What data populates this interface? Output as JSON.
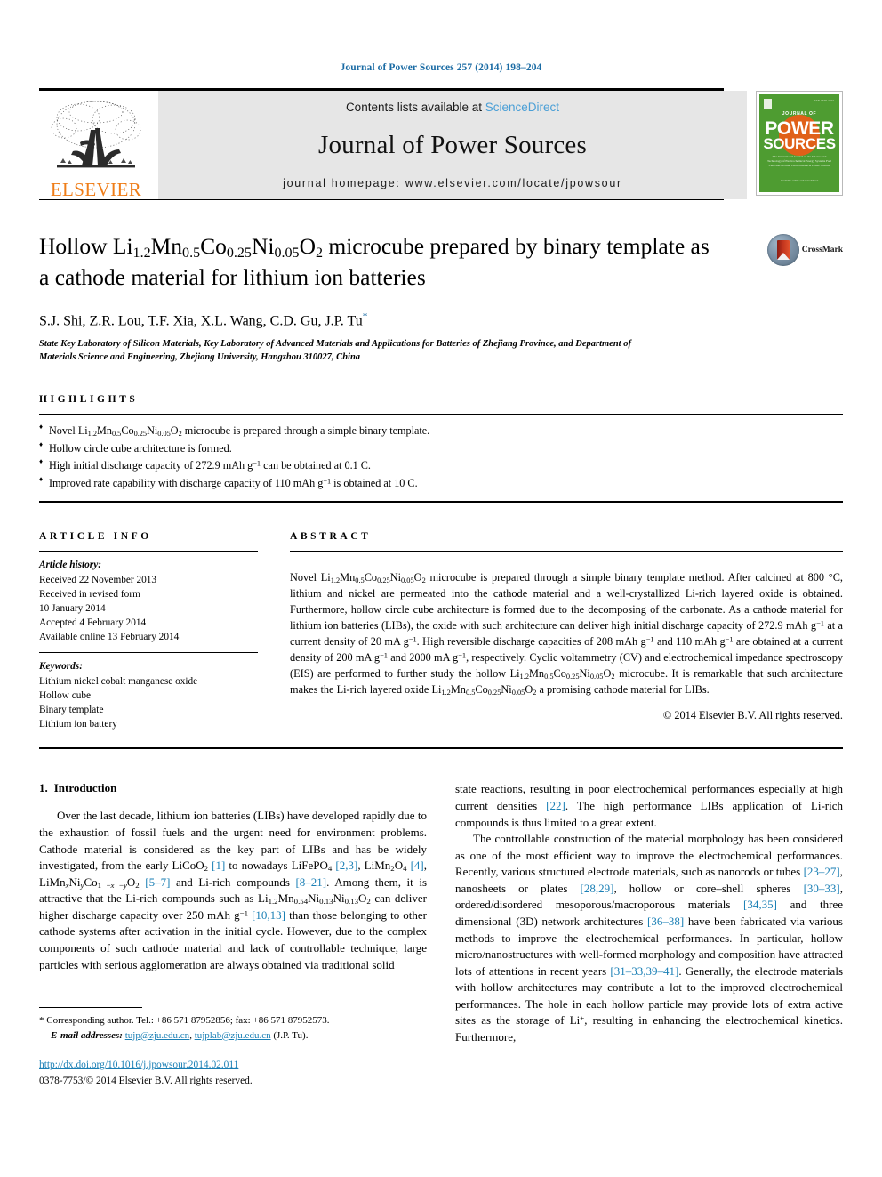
{
  "running_head": "Journal of Power Sources 257 (2014) 198–204",
  "masthead": {
    "publisher_logo_text": "ELSEVIER",
    "contents_prefix": "Contents lists available at ",
    "contents_link": "ScienceDirect",
    "journal_name": "Journal of Power Sources",
    "homepage_line": "journal homepage: www.elsevier.com/locate/jpowsour",
    "cover": {
      "journal_of": "JOURNAL OF",
      "power": "POWER",
      "sources": "SOURCES",
      "subtitle": "The International Journal on the Science and Technology of Electrochemical Energy Systems Fuel Cells and all other Electrochemical Power Sources",
      "footer": "Available online at\nScienceDirect"
    }
  },
  "title": {
    "part1": "Hollow Li",
    "sub1": "1.2",
    "part2": "Mn",
    "sub2": "0.5",
    "part3": "Co",
    "sub3": "0.25",
    "part4": "Ni",
    "sub4": "0.05",
    "part5": "O",
    "sub5": "2",
    "part6": " microcube prepared by binary template as a cathode material for lithium ion batteries",
    "full_text": "Hollow Li1.2Mn0.5Co0.25Ni0.05O2 microcube prepared by binary template as a cathode material for lithium ion batteries"
  },
  "crossmark": {
    "label": "CrossMark"
  },
  "authors": "S.J. Shi, Z.R. Lou, T.F. Xia, X.L. Wang, C.D. Gu, J.P. Tu",
  "author_marker": "*",
  "affiliation": "State Key Laboratory of Silicon Materials, Key Laboratory of Advanced Materials and Applications for Batteries of Zhejiang Province, and Department of Materials Science and Engineering, Zhejiang University, Hangzhou 310027, China",
  "highlights": {
    "heading": "HIGHLIGHTS",
    "items": [
      {
        "a": "Novel Li",
        "s1": "1.2",
        "b": "Mn",
        "s2": "0.5",
        "c": "Co",
        "s3": "0.25",
        "d": "Ni",
        "s4": "0.05",
        "e": "O",
        "s5": "2",
        "f": " microcube is prepared through a simple binary template."
      },
      {
        "plain": "Hollow circle cube architecture is formed."
      },
      {
        "pre": "High initial discharge capacity of 272.9 mAh g",
        "sup": "−1",
        "post": " can be obtained at 0.1 C."
      },
      {
        "pre": "Improved rate capability with discharge capacity of 110 mAh g",
        "sup": "−1",
        "post": " is obtained at 10 C."
      }
    ]
  },
  "article_info": {
    "heading": "ARTICLE INFO",
    "history_label": "Article history:",
    "history": [
      "Received 22 November 2013",
      "Received in revised form",
      "10 January 2014",
      "Accepted 4 February 2014",
      "Available online 13 February 2014"
    ],
    "keywords_label": "Keywords:",
    "keywords": [
      "Lithium nickel cobalt manganese oxide",
      "Hollow cube",
      "Binary template",
      "Lithium ion battery"
    ]
  },
  "abstract": {
    "heading": "ABSTRACT",
    "copyright": "© 2014 Elsevier B.V. All rights reserved."
  },
  "introduction": {
    "number": "1.",
    "heading": "Introduction"
  },
  "footnote": {
    "corresponding": "* Corresponding author. Tel.: +86 571 87952856; fax: +86 571 87952573.",
    "email_label": "E-mail addresses:",
    "email1": "tujp@zju.edu.cn",
    "email2": "tujplab@zju.edu.cn",
    "email_suffix": "(J.P. Tu).",
    "doi": "http://dx.doi.org/10.1016/j.jpowsour.2014.02.011",
    "issn_line": "0378-7753/© 2014 Elsevier B.V. All rights reserved."
  },
  "colors": {
    "running_head_blue": "#1a6ba4",
    "link_blue": "#1a7fb5",
    "sciencedirect_blue": "#4a9fd6",
    "elsevier_orange": "#ef7d18",
    "cover_green": "#4e9c31",
    "band_grey": "#e6e6e6"
  }
}
